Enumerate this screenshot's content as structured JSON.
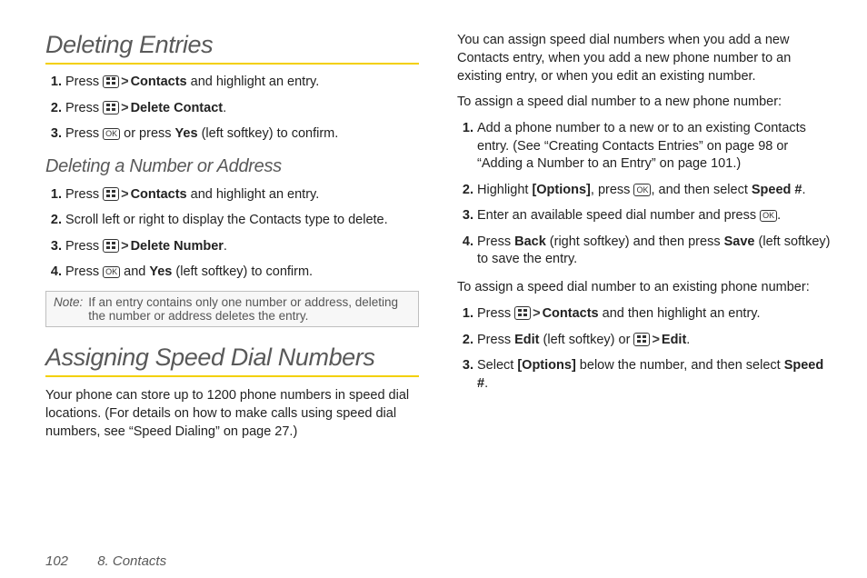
{
  "left": {
    "heading1": "Deleting Entries",
    "steps1": [
      {
        "prefix": "Press ",
        "menu": true,
        "gt": true,
        "bold1": "Contacts",
        "rest": " and highlight an entry."
      },
      {
        "prefix": "Press ",
        "menu": true,
        "gt": true,
        "bold1": "Delete Contact",
        "rest": "."
      },
      {
        "prefix": "Press ",
        "ok": true,
        "mid": " or press ",
        "bold1": "Yes",
        "rest": " (left softkey) to confirm."
      }
    ],
    "subheading": "Deleting a Number or Address",
    "steps2": [
      {
        "prefix": "Press ",
        "menu": true,
        "gt": true,
        "bold1": "Contacts",
        "rest": " and highlight an entry."
      },
      {
        "plain": "Scroll left or right to display the Contacts type to delete."
      },
      {
        "prefix": "Press ",
        "menu": true,
        "gt": true,
        "bold1": "Delete Number",
        "rest": "."
      },
      {
        "prefix": "Press ",
        "ok": true,
        "mid": " and ",
        "bold1": "Yes",
        "rest": " (left softkey) to confirm."
      }
    ],
    "note_label": "Note:",
    "note_text": "If an entry contains only one number or address, deleting the number or address deletes the entry.",
    "heading2": "Assigning Speed Dial Numbers",
    "para1": "Your phone can store up to 1200 phone numbers in speed dial locations. (For details on how to make calls using speed dial numbers, see “Speed Dialing” on page 27.)"
  },
  "right": {
    "intro": "You can assign speed dial numbers when you add a new Contacts entry, when you add a new phone number to an existing entry, or when you edit an existing number.",
    "lead1": "To assign a speed dial number to a new phone number:",
    "stepsA": [
      {
        "plain": "Add a phone number to a new or to an existing Contacts entry. (See “Creating Contacts Entries” on page 98 or “Adding a Number to an Entry” on page 101.)"
      },
      {
        "prefix": "Highlight ",
        "bold1": "[Options]",
        "mid1": ", press ",
        "ok": true,
        "mid2": ", and then select ",
        "bold2": "Speed #",
        "rest": "."
      },
      {
        "prefix": "Enter an available speed dial number and press ",
        "ok": true,
        "rest": "."
      },
      {
        "prefix": "Press ",
        "bold1": "Back",
        "mid1": " (right softkey) and then press ",
        "bold2": "Save",
        "rest": " (left softkey) to save the entry."
      }
    ],
    "lead2": "To assign a speed dial number to an existing phone number:",
    "stepsB": [
      {
        "prefix": "Press ",
        "menu": true,
        "gt": true,
        "bold1": "Contacts",
        "rest": " and then highlight an entry."
      },
      {
        "prefix": "Press ",
        "bold1": "Edit",
        "mid1": " (left softkey) or ",
        "menu": true,
        "gt": true,
        "bold2": "Edit",
        "rest": "."
      },
      {
        "prefix": "Select ",
        "bold1": "[Options]",
        "mid1": " below the number, and then select ",
        "bold2": "Speed #",
        "rest": "."
      }
    ]
  },
  "footer": {
    "page_number": "102",
    "section": "8. Contacts"
  }
}
